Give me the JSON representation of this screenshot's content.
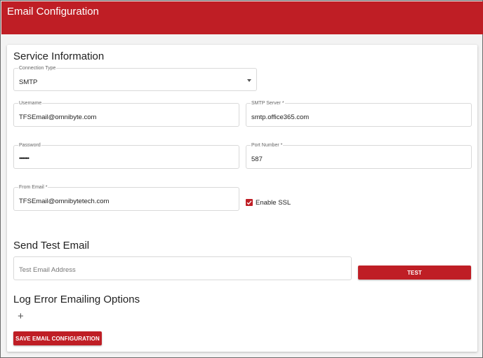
{
  "header": {
    "title": "Email Configuration"
  },
  "service": {
    "title": "Service Information",
    "connection_type": {
      "label": "Connection Type",
      "value": "SMTP"
    },
    "username": {
      "label": "Username",
      "value": "TFSEmail@omnibyte.com"
    },
    "smtp_server": {
      "label": "SMTP Server *",
      "value": "smtp.office365.com"
    },
    "password": {
      "label": "Password",
      "value": "••••••"
    },
    "port_number": {
      "label": "Port Number *",
      "value": "587"
    },
    "from_email": {
      "label": "From Email *",
      "value": "TFSEmail@omnibytetech.com"
    },
    "enable_ssl": {
      "label": "Enable SSL",
      "checked": true
    }
  },
  "test_email": {
    "title": "Send Test Email",
    "placeholder": "Test Email Address",
    "button_label": "TEST"
  },
  "log_error": {
    "title": "Log Error Emailing Options",
    "add_icon": "plus-icon"
  },
  "actions": {
    "save_label": "SAVE EMAIL CONFIGURATION"
  },
  "colors": {
    "accent": "#bf1e25"
  }
}
